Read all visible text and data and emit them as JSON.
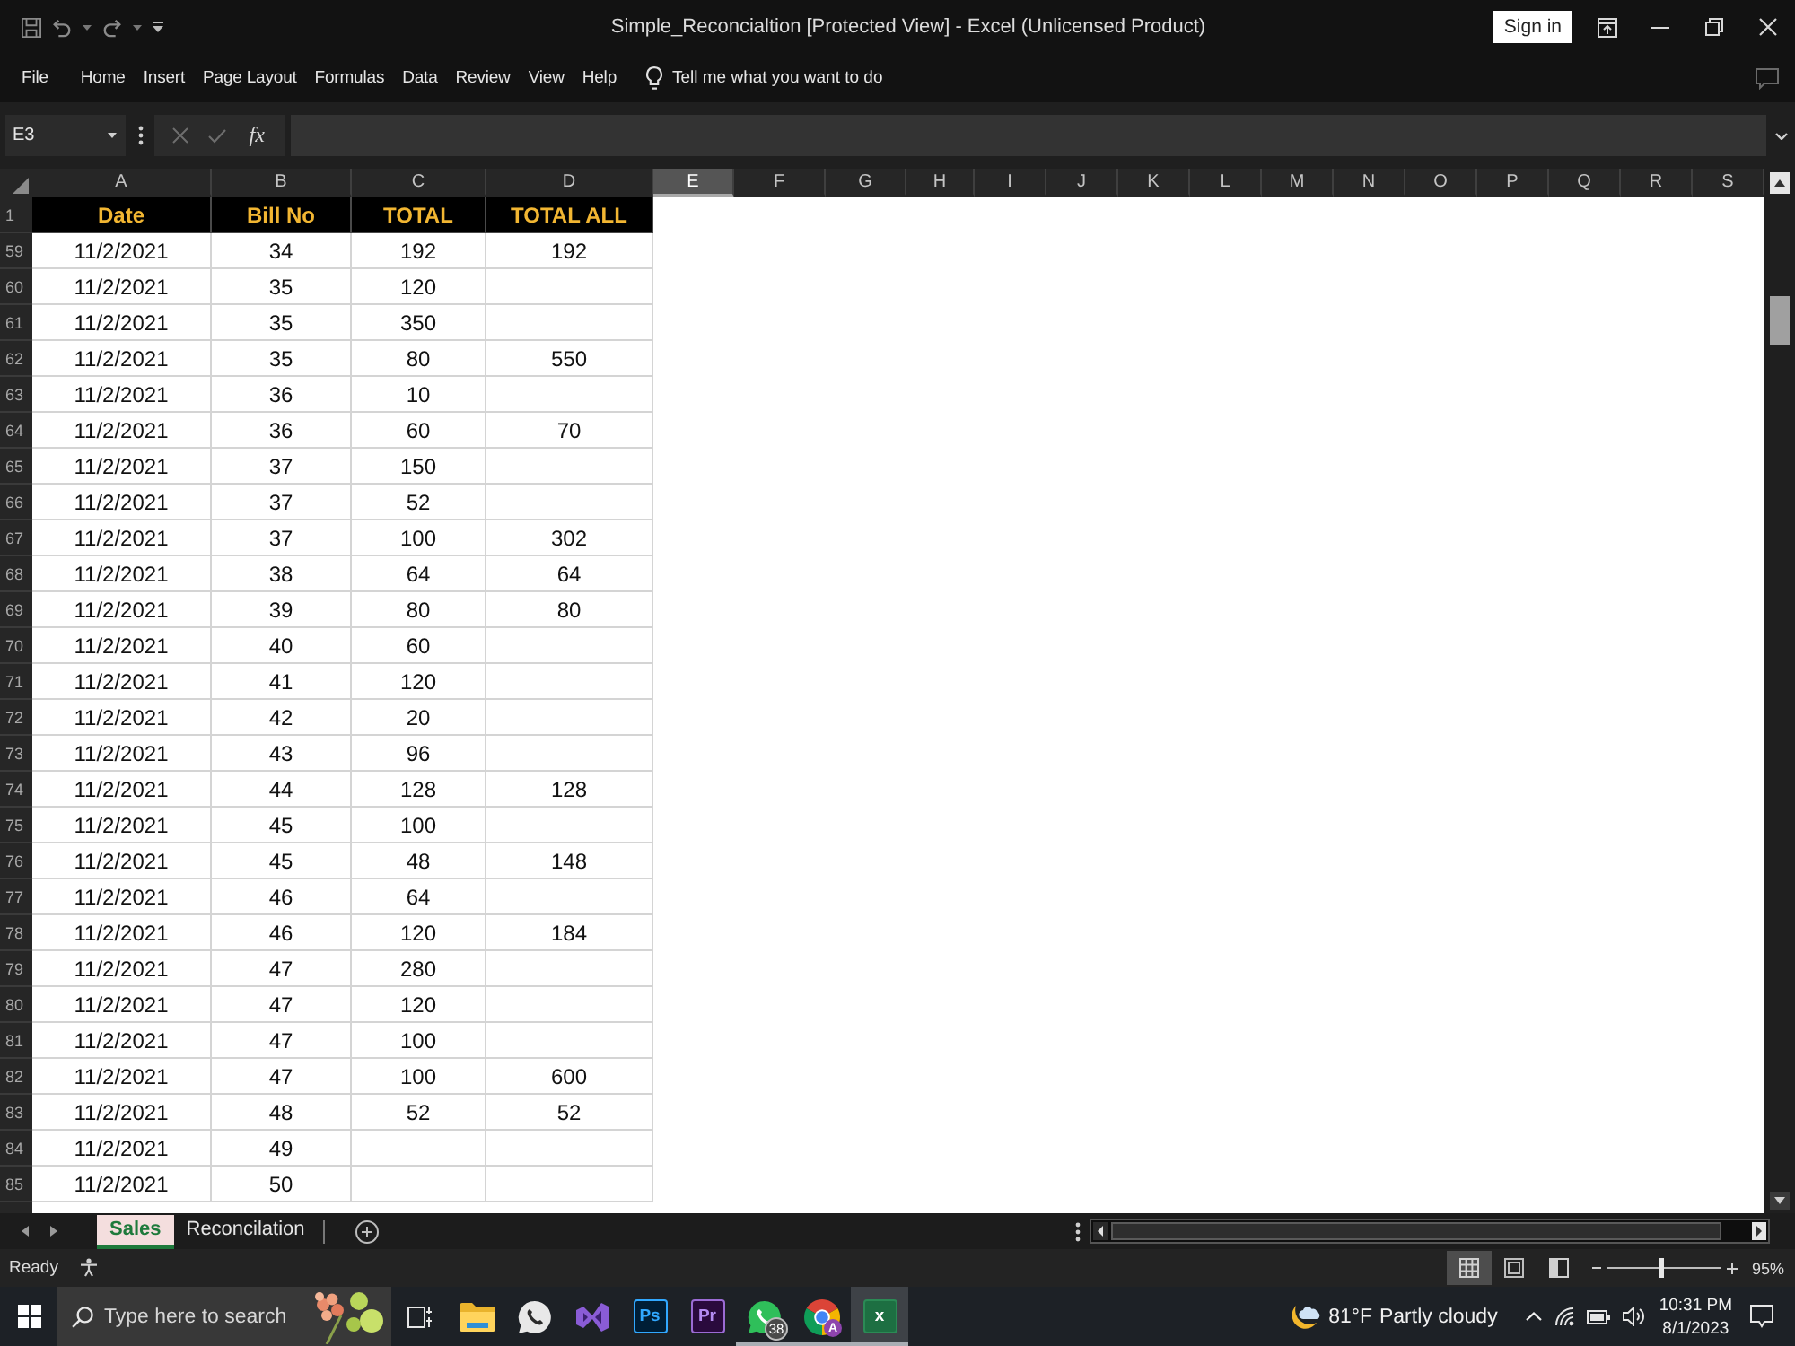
{
  "window": {
    "title": "Simple_Reconcialtion [Protected View] - Excel (Unlicensed Product)",
    "sign_in": "Sign in"
  },
  "menu": {
    "items": [
      "File",
      "Home",
      "Insert",
      "Page Layout",
      "Formulas",
      "Data",
      "Review",
      "View",
      "Help"
    ],
    "tell_me": "Tell me what you want to do"
  },
  "formula_bar": {
    "name_box": "E3",
    "function_label": "fx"
  },
  "sheet": {
    "columns": [
      {
        "label": "A",
        "selected": false
      },
      {
        "label": "B",
        "selected": false
      },
      {
        "label": "C",
        "selected": false
      },
      {
        "label": "D",
        "selected": false
      },
      {
        "label": "E",
        "selected": true
      },
      {
        "label": "F",
        "selected": false
      },
      {
        "label": "G",
        "selected": false
      },
      {
        "label": "H",
        "selected": false
      },
      {
        "label": "I",
        "selected": false
      },
      {
        "label": "J",
        "selected": false
      },
      {
        "label": "K",
        "selected": false
      },
      {
        "label": "L",
        "selected": false
      },
      {
        "label": "M",
        "selected": false
      },
      {
        "label": "N",
        "selected": false
      },
      {
        "label": "O",
        "selected": false
      },
      {
        "label": "P",
        "selected": false
      },
      {
        "label": "Q",
        "selected": false
      },
      {
        "label": "R",
        "selected": false
      },
      {
        "label": "S",
        "selected": false
      }
    ],
    "header_row": {
      "number": "1",
      "cells": [
        "Date",
        "Bill No",
        "TOTAL",
        "TOTAL ALL"
      ]
    },
    "rows": [
      {
        "number": "59",
        "cells": [
          "11/2/2021",
          "34",
          "192",
          "192"
        ]
      },
      {
        "number": "60",
        "cells": [
          "11/2/2021",
          "35",
          "120"
        ]
      },
      {
        "number": "61",
        "cells": [
          "11/2/2021",
          "35",
          "350"
        ]
      },
      {
        "number": "62",
        "cells": [
          "11/2/2021",
          "35",
          "80",
          "550"
        ]
      },
      {
        "number": "63",
        "cells": [
          "11/2/2021",
          "36",
          "10"
        ]
      },
      {
        "number": "64",
        "cells": [
          "11/2/2021",
          "36",
          "60",
          "70"
        ]
      },
      {
        "number": "65",
        "cells": [
          "11/2/2021",
          "37",
          "150"
        ]
      },
      {
        "number": "66",
        "cells": [
          "11/2/2021",
          "37",
          "52"
        ]
      },
      {
        "number": "67",
        "cells": [
          "11/2/2021",
          "37",
          "100",
          "302"
        ]
      },
      {
        "number": "68",
        "cells": [
          "11/2/2021",
          "38",
          "64",
          "64"
        ]
      },
      {
        "number": "69",
        "cells": [
          "11/2/2021",
          "39",
          "80",
          "80"
        ]
      },
      {
        "number": "70",
        "cells": [
          "11/2/2021",
          "40",
          "60"
        ]
      },
      {
        "number": "71",
        "cells": [
          "11/2/2021",
          "41",
          "120"
        ]
      },
      {
        "number": "72",
        "cells": [
          "11/2/2021",
          "42",
          "20"
        ]
      },
      {
        "number": "73",
        "cells": [
          "11/2/2021",
          "43",
          "96"
        ]
      },
      {
        "number": "74",
        "cells": [
          "11/2/2021",
          "44",
          "128",
          "128"
        ]
      },
      {
        "number": "75",
        "cells": [
          "11/2/2021",
          "45",
          "100"
        ]
      },
      {
        "number": "76",
        "cells": [
          "11/2/2021",
          "45",
          "48",
          "148"
        ]
      },
      {
        "number": "77",
        "cells": [
          "11/2/2021",
          "46",
          "64"
        ]
      },
      {
        "number": "78",
        "cells": [
          "11/2/2021",
          "46",
          "120",
          "184"
        ]
      },
      {
        "number": "79",
        "cells": [
          "11/2/2021",
          "47",
          "280"
        ]
      },
      {
        "number": "80",
        "cells": [
          "11/2/2021",
          "47",
          "120"
        ]
      },
      {
        "number": "81",
        "cells": [
          "11/2/2021",
          "47",
          "100"
        ]
      },
      {
        "number": "82",
        "cells": [
          "11/2/2021",
          "47",
          "100",
          "600"
        ]
      },
      {
        "number": "83",
        "cells": [
          "11/2/2021",
          "48",
          "52",
          "52"
        ]
      },
      {
        "number": "84",
        "cells": [
          "11/2/2021",
          "49"
        ]
      },
      {
        "number": "85",
        "cells": [
          "11/2/2021",
          "50"
        ]
      }
    ]
  },
  "sheet_tabs": [
    {
      "label": "Sales",
      "selected": true
    },
    {
      "label": "Reconcilation",
      "selected": false
    }
  ],
  "status_bar": {
    "text": "Ready",
    "views": [
      {
        "kind": "normal",
        "selected": true
      },
      {
        "kind": "page_layout",
        "selected": false
      },
      {
        "kind": "page_break",
        "selected": false
      }
    ],
    "zoom": {
      "level": 0.47,
      "reading": "95%"
    }
  },
  "taskbar": {
    "search": {
      "placeholder": "Type here to search"
    },
    "apps": [
      {
        "kind": "explorer",
        "running": false,
        "selected": false
      },
      {
        "kind": "chat",
        "running": false,
        "selected": false
      },
      {
        "kind": "visual_studio",
        "running": false,
        "selected": false
      },
      {
        "kind": "photoshop",
        "label": "Ps",
        "running": false,
        "selected": false
      },
      {
        "kind": "premiere",
        "label": "Pr",
        "running": false,
        "selected": false
      },
      {
        "kind": "whatsapp",
        "badge": "38",
        "running": true,
        "selected": false
      },
      {
        "kind": "chrome",
        "profile": "A",
        "running": true,
        "selected": false
      },
      {
        "kind": "excel",
        "label": "x",
        "running": true,
        "selected": true
      }
    ],
    "weather": {
      "temperature": "81°F",
      "condition": "Partly cloudy"
    },
    "time": "10:31 PM",
    "date": "8/1/2023"
  }
}
